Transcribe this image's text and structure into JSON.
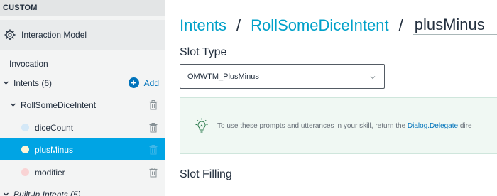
{
  "sidebar": {
    "section_title": "CUSTOM",
    "interaction_model": "Interaction Model",
    "invocation": "Invocation",
    "intents_label": "Intents (6)",
    "add_label": "Add",
    "intent_name": "RollSomeDiceIntent",
    "slots": [
      {
        "label": "diceCount",
        "dot_color": "#d4e8f7",
        "selected": false
      },
      {
        "label": "plusMinus",
        "dot_color": "#fff4d6",
        "selected": true
      },
      {
        "label": "modifier",
        "dot_color": "#f9d3d4",
        "selected": false
      }
    ],
    "builtin_label": "Built-In Intents (5)"
  },
  "main": {
    "breadcrumb": {
      "root": "Intents",
      "separator": "/",
      "intent": "RollSomeDiceIntent",
      "current": "plusMinus"
    },
    "slot_type_heading": "Slot Type",
    "slot_type_value": "OMWTM_PlusMinus",
    "info_text_before": "To use these prompts and utterances in your skill, return the ",
    "info_link": "Dialog.Delegate",
    "info_text_after": " dire",
    "slot_filling_heading": "Slot Filling"
  },
  "colors": {
    "accent": "#00a4e4",
    "link": "#0073bb",
    "breadcrumb_link": "#00a1c9"
  },
  "icons": {
    "model": "gear-icon",
    "expand": "chevron-down-icon",
    "delete": "trash-icon",
    "add": "plus-circle-icon",
    "tip": "lightbulb-icon",
    "dropdown": "chevron-down-icon"
  }
}
